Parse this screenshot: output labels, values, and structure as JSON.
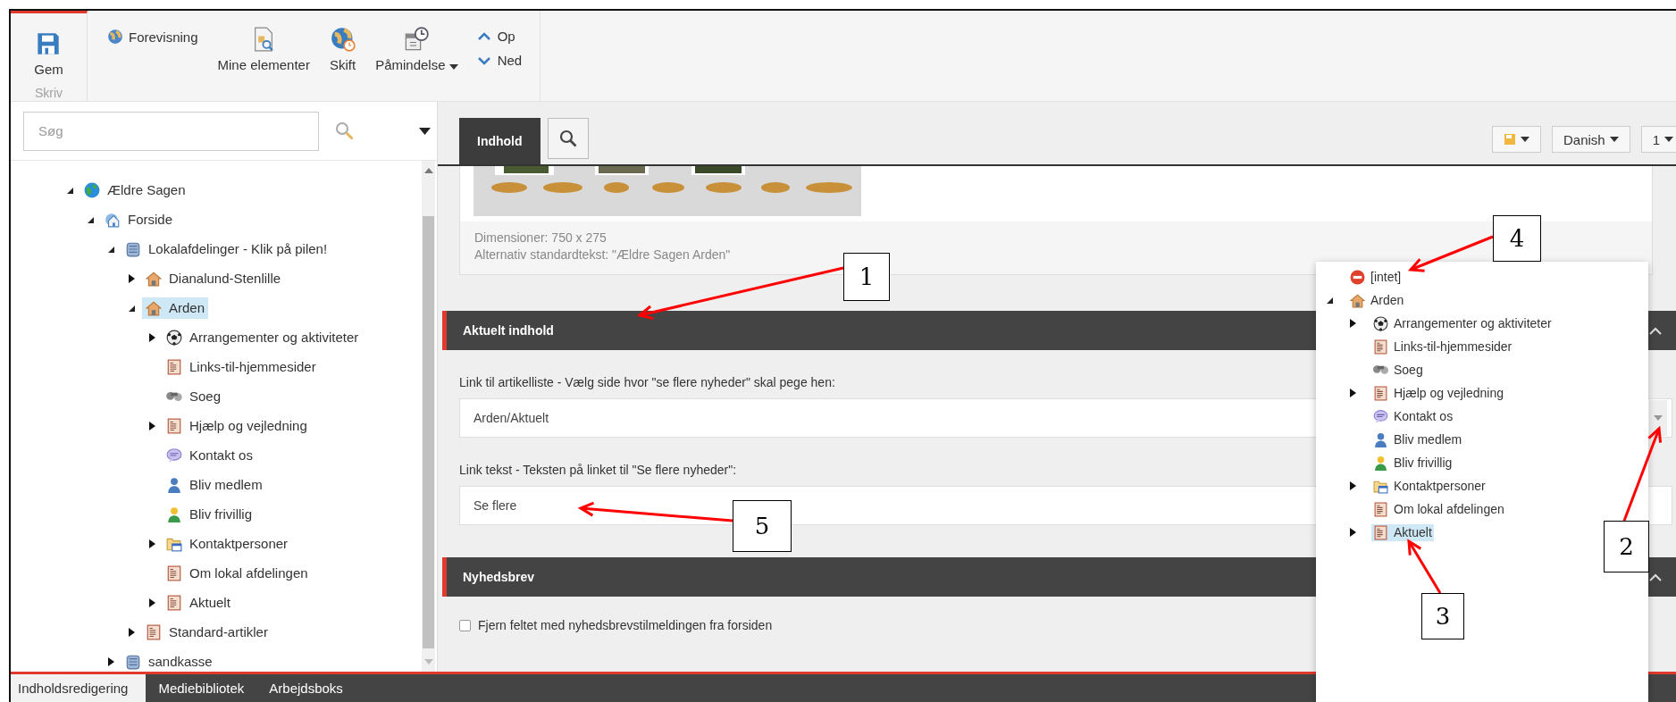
{
  "toolbar": {
    "save": {
      "label": "Gem",
      "group_label": "Skriv"
    },
    "buttons": [
      {
        "kind": "small",
        "label": "Forevisning"
      },
      {
        "kind": "large",
        "label": "Mine elementer"
      },
      {
        "kind": "large",
        "label": "Skift"
      },
      {
        "kind": "dropdown",
        "label": "Påmindelse"
      },
      {
        "kind": "stack",
        "items": [
          "Op",
          "Ned"
        ]
      }
    ]
  },
  "search": {
    "placeholder": "Søg"
  },
  "tree": [
    {
      "label": "Ældre Sagen",
      "kind": "globe",
      "expanded": true,
      "selected": false,
      "children": [
        {
          "label": "Forside",
          "kind": "webhome",
          "expanded": true,
          "selected": false,
          "children": [
            {
              "label": "Lokalafdelinger - Klik på pilen!",
              "kind": "database",
              "expanded": true,
              "selected": false,
              "children": [
                {
                  "label": "Dianalund-Stenlille",
                  "kind": "house",
                  "expanded": false,
                  "selected": false
                },
                {
                  "label": "Arden",
                  "kind": "house",
                  "expanded": true,
                  "selected": true,
                  "children": [
                    {
                      "label": "Arrangementer og aktiviteter",
                      "kind": "ball",
                      "expanded": false,
                      "selected": false
                    },
                    {
                      "label": "Links-til-hjemmesider",
                      "kind": "page",
                      "selected": false
                    },
                    {
                      "label": "Soeg",
                      "kind": "binoculars",
                      "selected": false
                    },
                    {
                      "label": "Hjælp og vejledning",
                      "kind": "page",
                      "expanded": false,
                      "selected": false
                    },
                    {
                      "label": "Kontakt os",
                      "kind": "speech",
                      "selected": false
                    },
                    {
                      "label": "Bliv medlem",
                      "kind": "person",
                      "selected": false
                    },
                    {
                      "label": "Bliv frivillig",
                      "kind": "volunteer",
                      "selected": false
                    },
                    {
                      "label": "Kontaktpersoner",
                      "kind": "folder",
                      "expanded": false,
                      "selected": false
                    },
                    {
                      "label": "Om lokal afdelingen",
                      "kind": "page",
                      "selected": false
                    },
                    {
                      "label": "Aktuelt",
                      "kind": "page",
                      "expanded": false,
                      "selected": false
                    }
                  ]
                },
                {
                  "label": "Standard-artikler",
                  "kind": "page",
                  "expanded": false,
                  "selected": false
                }
              ]
            },
            {
              "label": "sandkasse",
              "kind": "database",
              "expanded": false,
              "selected": false
            }
          ]
        }
      ]
    }
  ],
  "editor_tabs": [
    {
      "kind": "text",
      "label": "Indhold",
      "selected": true
    },
    {
      "kind": "search",
      "selected": false
    }
  ],
  "top_buttons": [
    {
      "kind": "icon"
    },
    {
      "kind": "text",
      "label": "Danish"
    },
    {
      "kind": "text",
      "label": "1"
    }
  ],
  "image_field": {
    "dimensions": "Dimensioner: 750 x 275",
    "alt_text": "Alternativ standardtekst: \"Ældre Sagen Arden\""
  },
  "sections": [
    {
      "title": "Aktuelt indhold",
      "fields": [
        {
          "kind": "link",
          "label": "Link til artikelliste - Vælg side hvor \"se flere nyheder\" skal pege hen:",
          "value": "Arden/Aktuelt"
        },
        {
          "kind": "text",
          "label": "Link tekst - Teksten på linket til \"Se flere nyheder\":",
          "value": "Se flere"
        }
      ]
    },
    {
      "title": "Nyhedsbrev",
      "fields": [
        {
          "kind": "checkbox",
          "label": "Fjern feltet med nyhedsbrevstilmeldingen fra forsiden",
          "checked": false
        }
      ]
    }
  ],
  "link_picker": [
    {
      "label": "[intet]",
      "kind": "none",
      "selected": false
    },
    {
      "label": "Arden",
      "kind": "house",
      "expanded": true,
      "selected": false,
      "children": [
        {
          "label": "Arrangementer og aktiviteter",
          "kind": "ball",
          "expanded": false,
          "selected": false
        },
        {
          "label": "Links-til-hjemmesider",
          "kind": "page",
          "selected": false
        },
        {
          "label": "Soeg",
          "kind": "binoculars",
          "selected": false
        },
        {
          "label": "Hjælp og vejledning",
          "kind": "page",
          "expanded": false,
          "selected": false
        },
        {
          "label": "Kontakt os",
          "kind": "speech",
          "selected": false
        },
        {
          "label": "Bliv medlem",
          "kind": "person",
          "selected": false
        },
        {
          "label": "Bliv frivillig",
          "kind": "volunteer",
          "selected": false
        },
        {
          "label": "Kontaktpersoner",
          "kind": "folder",
          "expanded": false,
          "selected": false
        },
        {
          "label": "Om lokal afdelingen",
          "kind": "page",
          "selected": false
        },
        {
          "label": "Aktuelt",
          "kind": "page",
          "expanded": false,
          "selected": true
        }
      ]
    }
  ],
  "bottom_tabs": [
    {
      "label": "Indholdsredigering",
      "selected": true
    },
    {
      "label": "Mediebibliotek",
      "selected": false
    },
    {
      "label": "Arbejdsboks",
      "selected": false
    }
  ],
  "annotations": [
    "4",
    "1",
    "5",
    "2",
    "3"
  ]
}
